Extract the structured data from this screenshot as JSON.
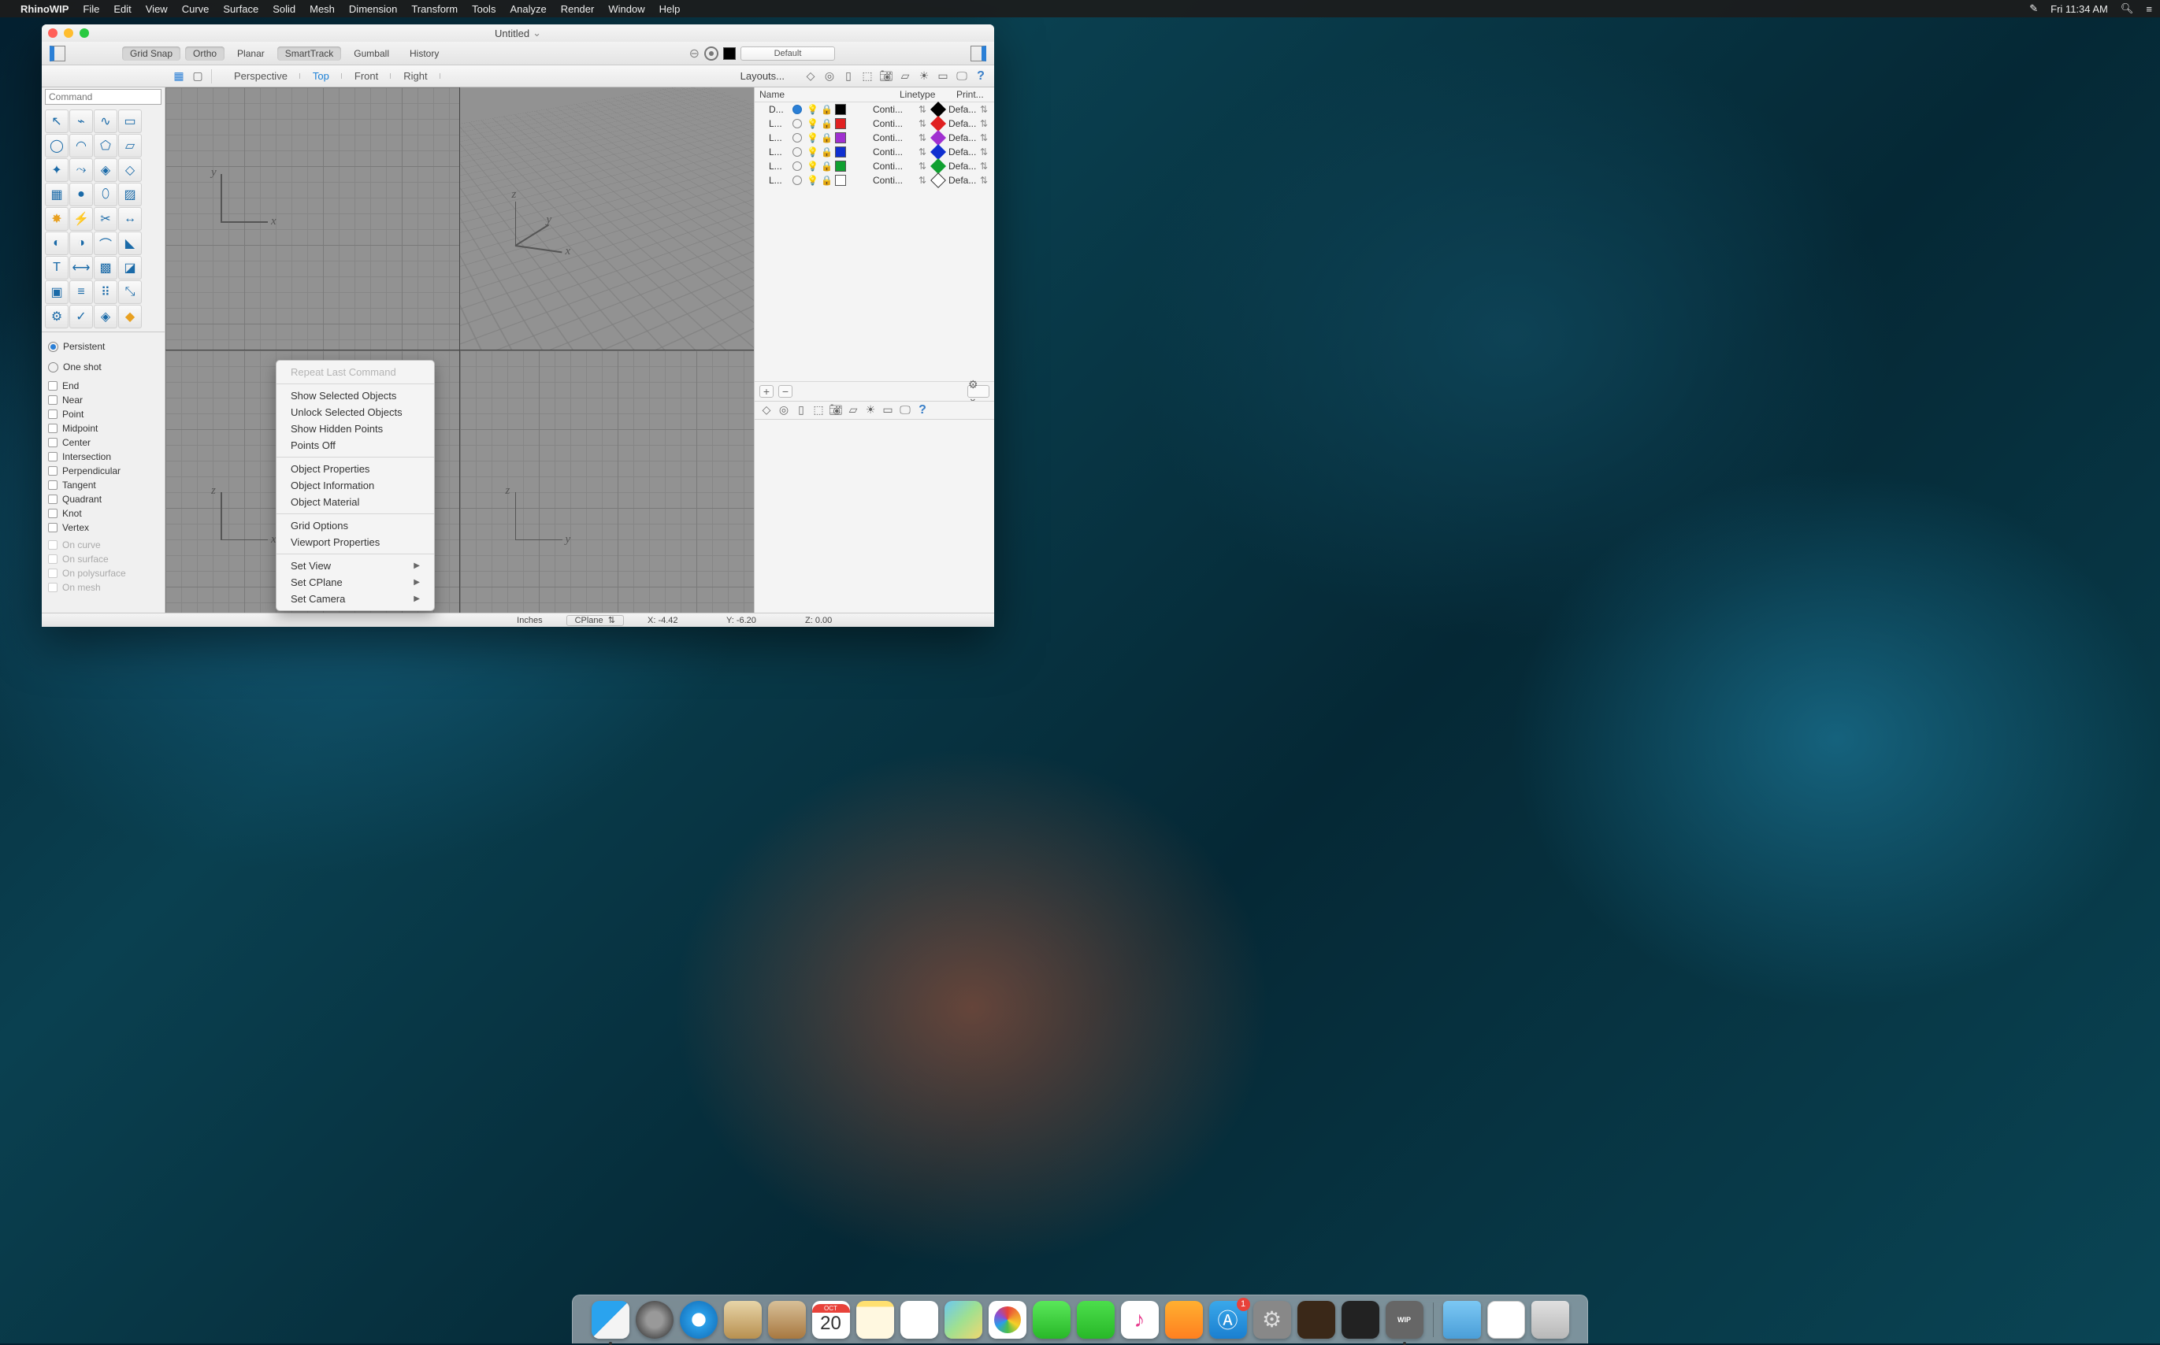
{
  "menubar": {
    "app": "RhinoWIP",
    "items": [
      "File",
      "Edit",
      "View",
      "Curve",
      "Surface",
      "Solid",
      "Mesh",
      "Dimension",
      "Transform",
      "Tools",
      "Analyze",
      "Render",
      "Window",
      "Help"
    ],
    "clock": "Fri 11:34 AM"
  },
  "window": {
    "title": "Untitled"
  },
  "toolbar1": {
    "buttons": [
      "Grid Snap",
      "Ortho",
      "Planar",
      "SmartTrack",
      "Gumball",
      "History"
    ],
    "pressed": [
      true,
      true,
      false,
      true,
      false,
      false
    ],
    "layer_select": "Default"
  },
  "toolbar2": {
    "tabs": [
      "Perspective",
      "Top",
      "Front",
      "Right"
    ],
    "active": 1,
    "layouts": "Layouts..."
  },
  "command_placeholder": "Command",
  "osnap": {
    "persist": "Persistent",
    "oneshot": "One shot",
    "items": [
      "End",
      "Near",
      "Point",
      "Midpoint",
      "Center",
      "Intersection",
      "Perpendicular",
      "Tangent",
      "Quadrant",
      "Knot",
      "Vertex"
    ],
    "dis_items": [
      "On curve",
      "On surface",
      "On polysurface",
      "On mesh"
    ]
  },
  "context_menu": {
    "repeat": "Repeat Last Command",
    "g1": [
      "Show Selected Objects",
      "Unlock Selected Objects",
      "Show Hidden Points",
      "Points Off"
    ],
    "g2": [
      "Object Properties",
      "Object Information",
      "Object Material"
    ],
    "g3": [
      "Grid Options",
      "Viewport Properties"
    ],
    "sub": [
      "Set View",
      "Set CPlane",
      "Set Camera"
    ]
  },
  "layers": {
    "cols": {
      "name": "Name",
      "linetype": "Linetype",
      "print": "Print..."
    },
    "rows": [
      {
        "n": "D...",
        "current": true,
        "c": "#000000",
        "lt": "Conti...",
        "d": "#000000",
        "p": "Defa..."
      },
      {
        "n": "L...",
        "current": false,
        "c": "#e02020",
        "lt": "Conti...",
        "d": "#e02020",
        "p": "Defa..."
      },
      {
        "n": "L...",
        "current": false,
        "c": "#a030d0",
        "lt": "Conti...",
        "d": "#a030d0",
        "p": "Defa..."
      },
      {
        "n": "L...",
        "current": false,
        "c": "#1030d0",
        "lt": "Conti...",
        "d": "#1030d0",
        "p": "Defa..."
      },
      {
        "n": "L...",
        "current": false,
        "c": "#10a030",
        "lt": "Conti...",
        "d": "#10a030",
        "p": "Defa..."
      },
      {
        "n": "L...",
        "current": false,
        "c": "#ffffff",
        "lt": "Conti...",
        "d": "#ffffff",
        "p": "Defa..."
      }
    ]
  },
  "status": {
    "units": "Inches",
    "sys": "CPlane",
    "x": "X: -4.42",
    "y": "Y: -6.20",
    "z": "Z: 0.00"
  },
  "dock": {
    "cal_month": "OCT",
    "cal_day": "20",
    "appstore_badge": "1",
    "rhino_label": "WIP"
  },
  "axes": {
    "x": "x",
    "y": "y",
    "z": "z"
  },
  "icons": {
    "panel": [
      "layer-stack-icon",
      "material-icon",
      "page-icon",
      "cube-icon",
      "camera-icon",
      "shape-icon",
      "sun-icon",
      "rect-icon",
      "monitor-icon"
    ]
  }
}
